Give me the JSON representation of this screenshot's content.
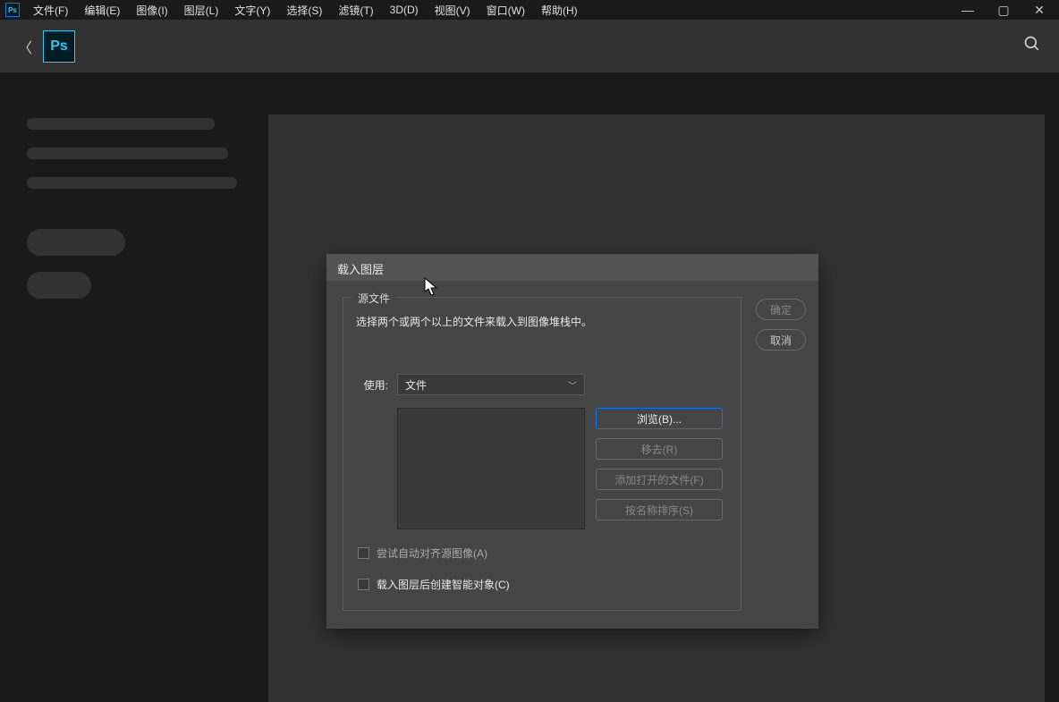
{
  "menu": {
    "items": [
      "文件(F)",
      "编辑(E)",
      "图像(I)",
      "图层(L)",
      "文字(Y)",
      "选择(S)",
      "滤镜(T)",
      "3D(D)",
      "视图(V)",
      "窗口(W)",
      "帮助(H)"
    ]
  },
  "logo_small": "Ps",
  "logo_large": "Ps",
  "dialog": {
    "title": "载入图层",
    "fieldset_legend": "源文件",
    "description": "选择两个或两个以上的文件来载入到图像堆栈中。",
    "use_label": "使用:",
    "dropdown_value": "文件",
    "browse_btn": "浏览(B)...",
    "remove_btn": "移去(R)",
    "add_open_btn": "添加打开的文件(F)",
    "sort_btn": "按名称排序(S)",
    "checkbox_align": "尝试自动对齐源图像(A)",
    "checkbox_smart": "载入图层后创建智能对象(C)",
    "ok_btn": "确定",
    "cancel_btn": "取消"
  }
}
